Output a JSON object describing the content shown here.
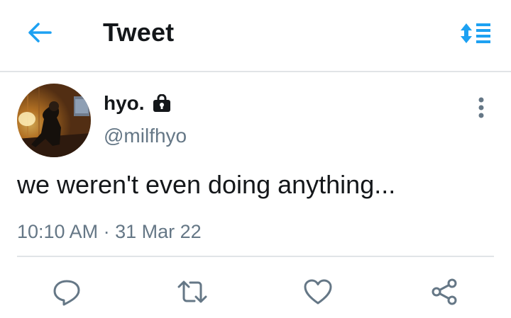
{
  "header": {
    "title": "Tweet",
    "back_icon": "arrow-left-icon",
    "sort_icon": "sort-arrows-icon"
  },
  "tweet": {
    "display_name": "hyo.",
    "handle": "@milfhyo",
    "protected_icon": "lock-icon",
    "text": "we weren't even doing anything...",
    "time": "10:10 AM",
    "separator": "·",
    "date": "31 Mar 22"
  },
  "actions": [
    {
      "icon": "reply-icon"
    },
    {
      "icon": "retweet-icon"
    },
    {
      "icon": "like-icon"
    },
    {
      "icon": "share-icon"
    }
  ],
  "colors": {
    "accent": "#1da1f2",
    "text": "#14171a",
    "secondary": "#657786",
    "divider": "#e1e4e7"
  }
}
